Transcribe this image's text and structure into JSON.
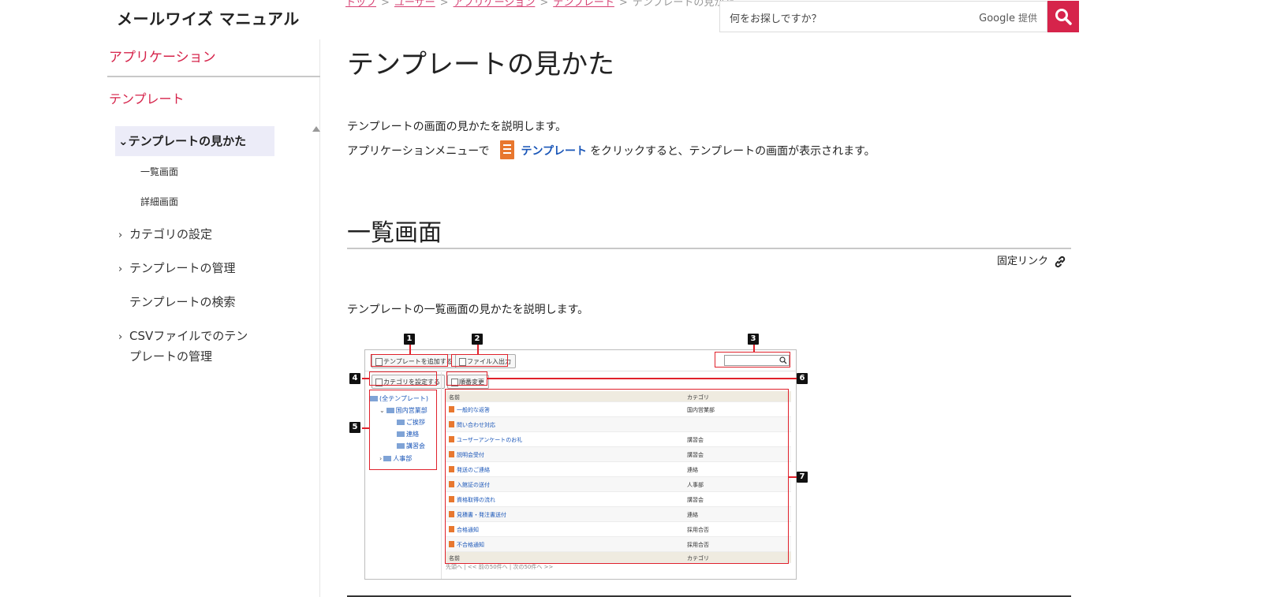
{
  "header": {
    "site_title": "メールワイズ マニュアル",
    "breadcrumb": [
      "トップ",
      "ユーザー",
      "アプリケーション",
      "テンプレート"
    ],
    "breadcrumb_current": "テンプレートの見かた",
    "search_placeholder": "何をお探しですか？",
    "search_brand": "Google",
    "search_brand_suffix": "提供"
  },
  "sidebar": {
    "app_label": "アプリケーション",
    "section_label": "テンプレート",
    "active_item": "テンプレートの見かた",
    "sub_items": [
      "一覧画面",
      "詳細画面"
    ],
    "items": [
      {
        "label": "カテゴリの設定",
        "expandable": true
      },
      {
        "label": "テンプレートの管理",
        "expandable": true
      },
      {
        "label": "テンプレートの検索",
        "expandable": false
      },
      {
        "label_line1": "CSVファイルでのテン",
        "label_line2": "プレートの管理",
        "expandable": true
      }
    ]
  },
  "main": {
    "title": "テンプレートの見かた",
    "intro_line1": "テンプレートの画面の見かたを説明します。",
    "intro_line2_prefix": "アプリケーションメニューで",
    "intro_link": "テンプレート",
    "intro_line2_suffix": "をクリックすると、テンプレートの画面が表示されます。",
    "section_title": "一覧画面",
    "permalink": "固定リンク",
    "section_desc": "テンプレートの一覧画面の見かたを説明します。"
  },
  "screenshot": {
    "buttons": {
      "add_template": "テンプレートを追加する",
      "file_io": "ファイル入出力",
      "set_category": "カテゴリを設定する",
      "reorder": "順番変更"
    },
    "tree": {
      "all": "(全テンプレート)",
      "domestic": "国内営業部",
      "greeting": "ご挨拶",
      "contact": "連絡",
      "seminar": "講習会",
      "hr": "人事部"
    },
    "table_headers": {
      "name": "名前",
      "category": "カテゴリ"
    },
    "rows": [
      {
        "name": "一般的な返答",
        "category": "国内営業部"
      },
      {
        "name": "問い合わせ対応",
        "category": ""
      },
      {
        "name": "ユーザーアンケートのお礼",
        "category": "講習会"
      },
      {
        "name": "説明会受付",
        "category": "講習会"
      },
      {
        "name": "発送のご連絡",
        "category": "連絡"
      },
      {
        "name": "入館証の送付",
        "category": "人事部"
      },
      {
        "name": "資格取得の流れ",
        "category": "講習会"
      },
      {
        "name": "見積書・発注書送付",
        "category": "連絡"
      },
      {
        "name": "合格通知",
        "category": "採用合否"
      },
      {
        "name": "不合格通知",
        "category": "採用合否"
      }
    ],
    "pager": "先頭へ | << 前の50件へ | 次の50件へ >>",
    "badges": [
      "1",
      "2",
      "3",
      "4",
      "5",
      "6",
      "7"
    ]
  },
  "colors": {
    "accent": "#d6244b",
    "link": "#1a56b8",
    "callout": "#e0212b",
    "app_icon": "#e8772e"
  }
}
